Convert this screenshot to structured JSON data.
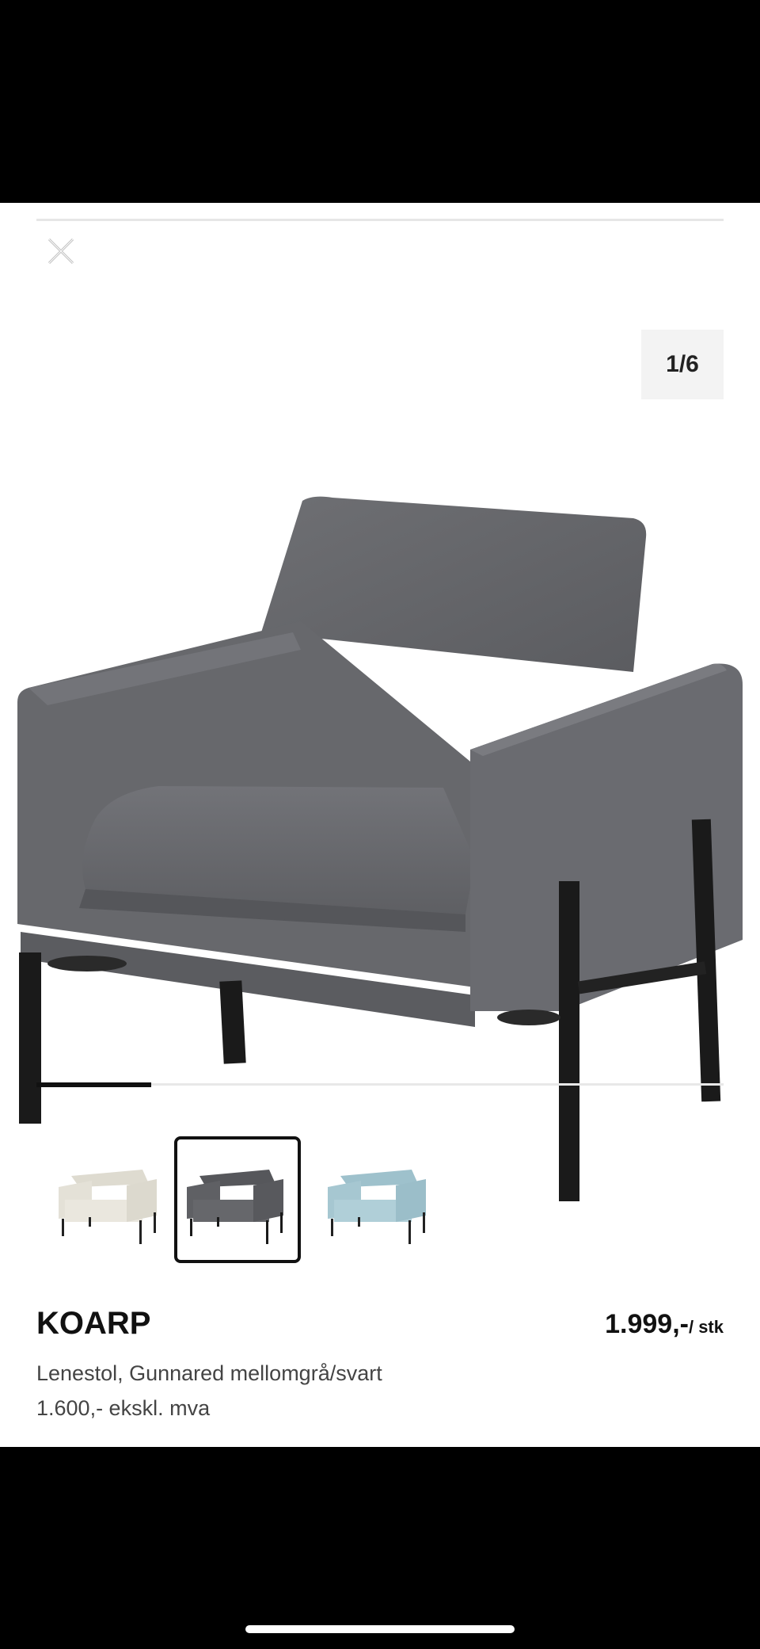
{
  "viewer": {
    "counter": "1/6",
    "progress_fraction": 0.1667
  },
  "variants": [
    {
      "color": "#e9e5da",
      "selected": false
    },
    {
      "color": "#5d5f63",
      "selected": true
    },
    {
      "color": "#a9c9d4",
      "selected": false
    }
  ],
  "product": {
    "name": "KOARP",
    "price": "1.999,-",
    "price_unit": "/ stk",
    "description": "Lenestol, Gunnared mellomgrå/svart",
    "price_ex_vat": "1.600,- ekskl. mva"
  }
}
